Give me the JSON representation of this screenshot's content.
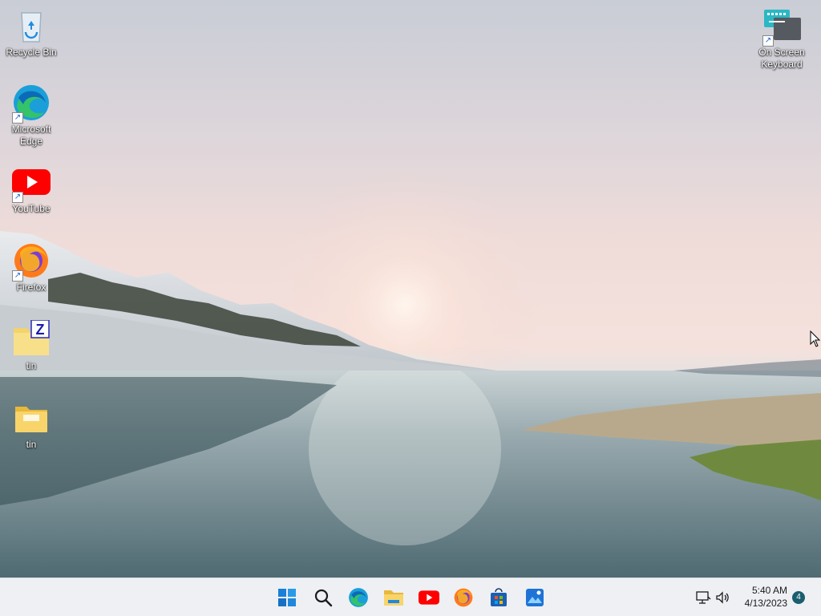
{
  "desktop": {
    "icons": [
      {
        "name": "recycle-bin",
        "label": "Recycle Bin"
      },
      {
        "name": "microsoft-edge",
        "label": "Microsoft\nEdge"
      },
      {
        "name": "youtube",
        "label": "YouTube"
      },
      {
        "name": "firefox",
        "label": "Firefox"
      },
      {
        "name": "tin-zip",
        "label": "tin"
      },
      {
        "name": "tin-folder",
        "label": "tin"
      },
      {
        "name": "on-screen-keyboard",
        "label": "On Screen\nKeyboard"
      }
    ]
  },
  "taskbar": {
    "apps": [
      "start-icon",
      "search-icon",
      "edge-icon",
      "file-explorer-icon",
      "youtube-icon",
      "firefox-icon",
      "store-icon",
      "photos-icon"
    ],
    "tray_icons": [
      "network-icon",
      "volume-icon"
    ],
    "time": "5:40 AM",
    "date": "4/13/2023",
    "notification_count": "4"
  },
  "colors": {
    "taskbar_bg": "#eef0f4",
    "accent": "#0067c0",
    "notif_badge": "#1b5e6e"
  }
}
